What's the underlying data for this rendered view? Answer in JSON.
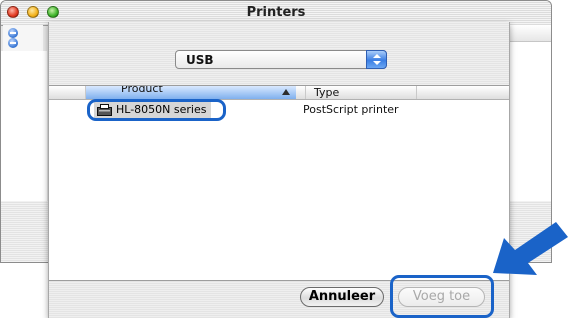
{
  "window": {
    "title": "Printers"
  },
  "sheet": {
    "connection_popup": {
      "selected": "USB"
    },
    "table": {
      "columns": [
        "Product",
        "Type"
      ],
      "rows": [
        {
          "product": "HL-8050N series",
          "type": "PostScript printer"
        }
      ]
    },
    "buttons": {
      "cancel": "Annuleer",
      "add": "Voeg toe"
    }
  },
  "colors": {
    "highlight": "#1a63c8",
    "arrow": "#1a63c8"
  },
  "icons": [
    "close-icon",
    "minimize-icon",
    "zoom-icon",
    "remove-icon",
    "popup-arrows-icon",
    "sort-ascending-icon",
    "printer-icon",
    "pointer-arrow-icon"
  ]
}
